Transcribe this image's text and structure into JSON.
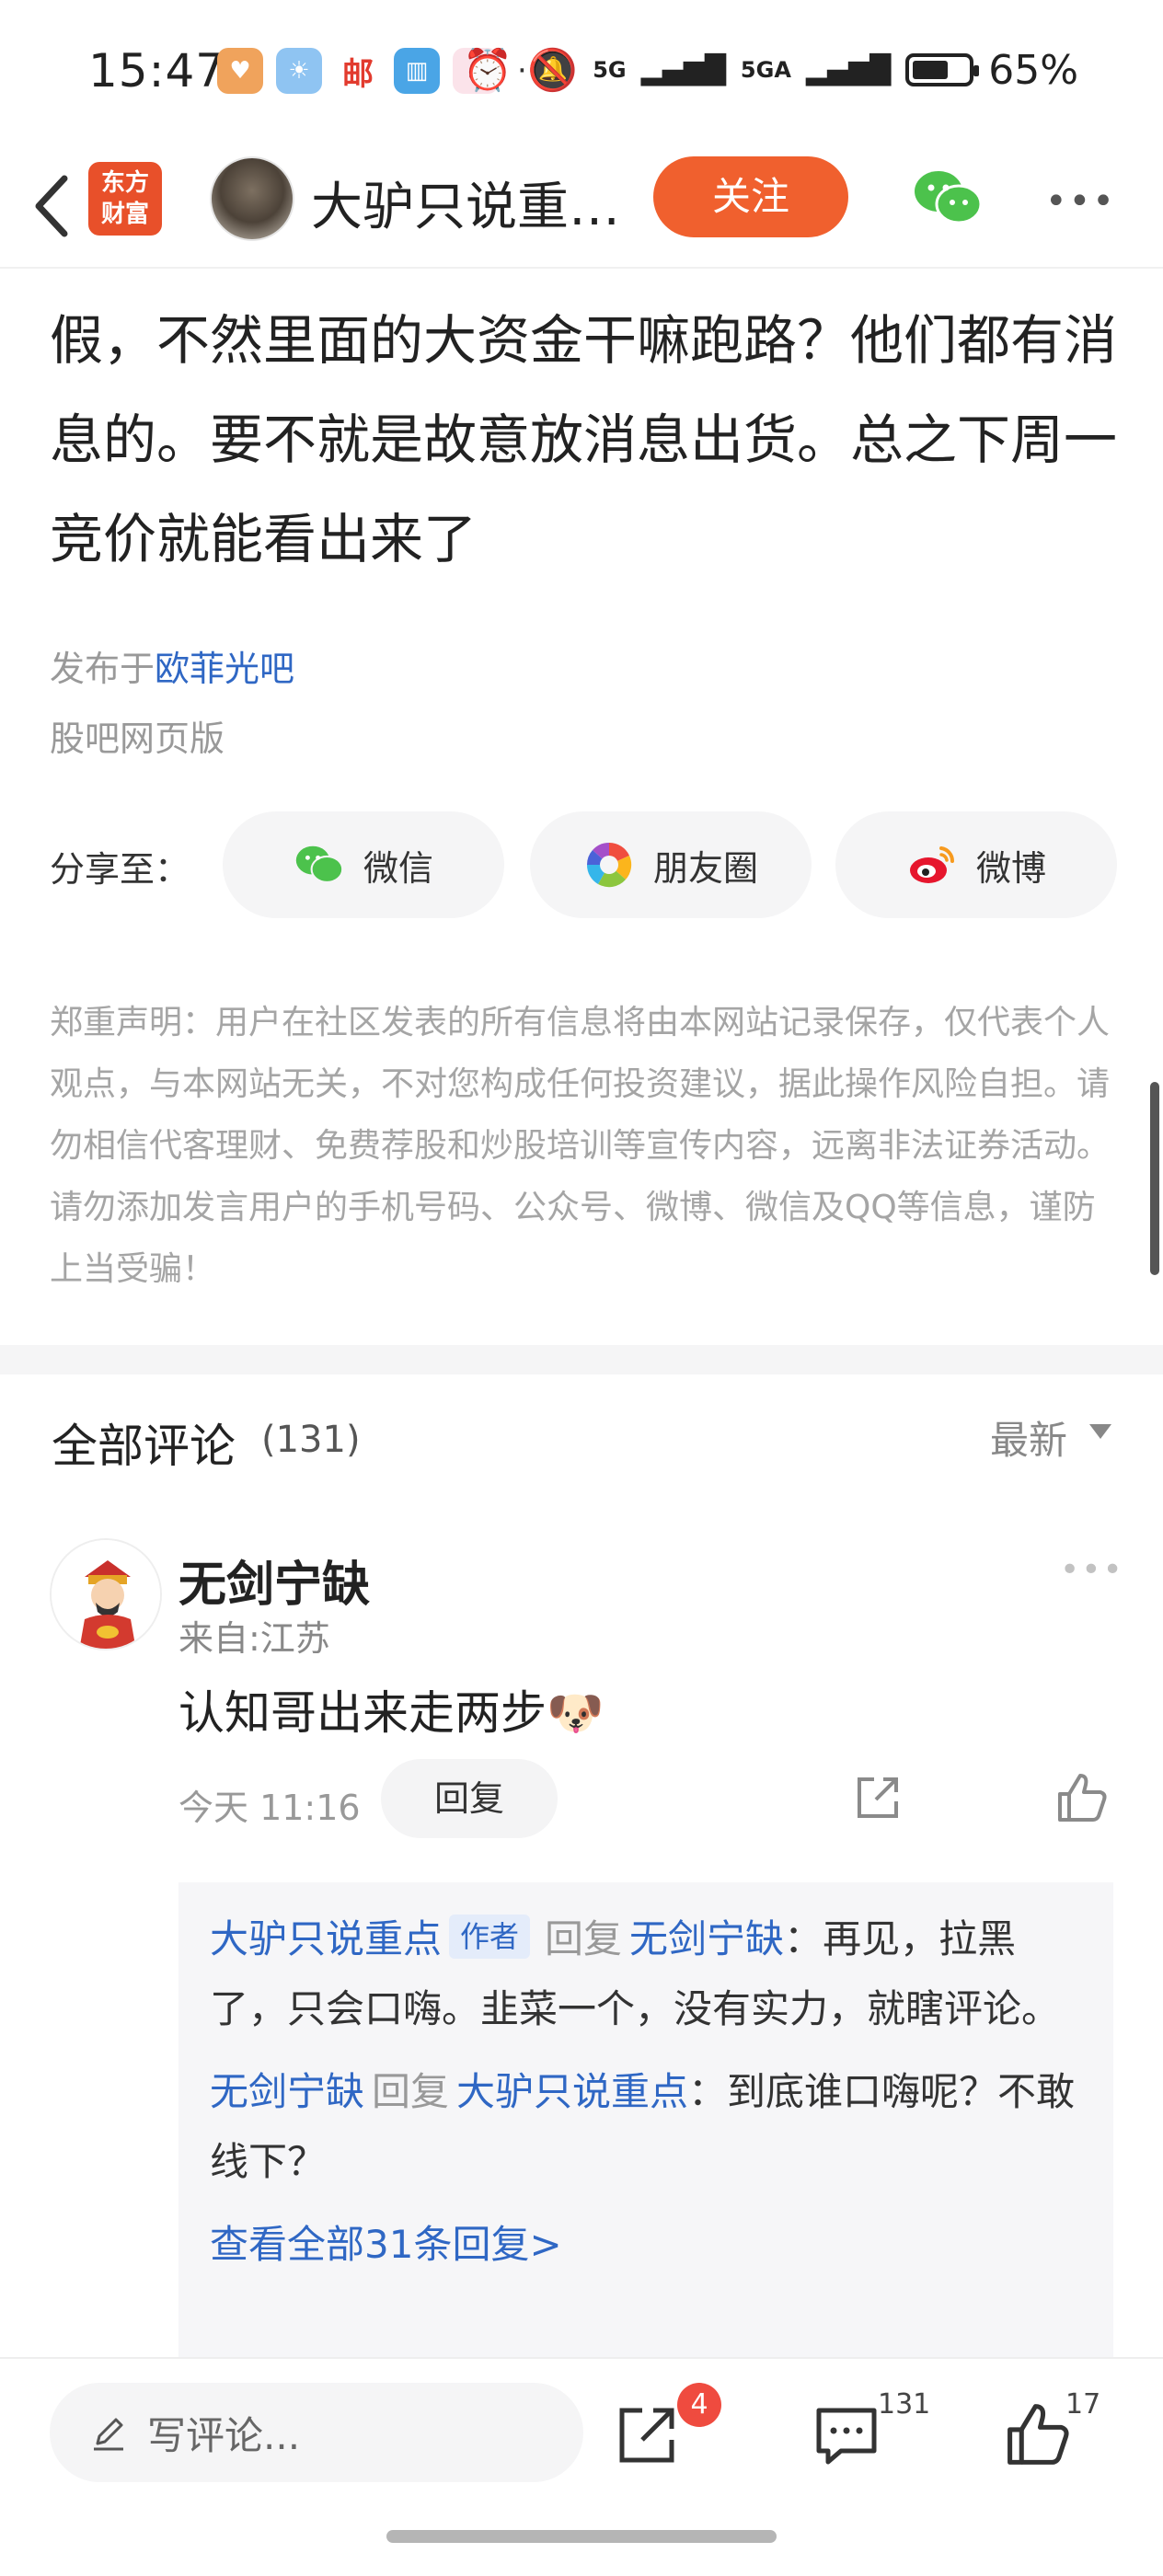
{
  "status_bar": {
    "time": "15:47",
    "network_1": "5G",
    "network_2": "5GA",
    "battery": "65%",
    "battery_level": 0.65
  },
  "header": {
    "logo_line1": "东方",
    "logo_line2": "财富",
    "title": "大驴只说重…",
    "follow_label": "关注"
  },
  "article": {
    "text": "假，不然里面的大资金干嘛跑路？他们都有消息的。要不就是故意放消息出货。总之下周一竞价就能看出来了",
    "published_prefix": "发布于",
    "published_bar": "欧菲光吧",
    "source": "股吧网页版"
  },
  "share": {
    "label": "分享至：",
    "buttons": [
      {
        "label": "微信",
        "icon": "wechat-icon"
      },
      {
        "label": "朋友圈",
        "icon": "moments-icon"
      },
      {
        "label": "微博",
        "icon": "weibo-icon"
      }
    ]
  },
  "disclaimer": "郑重声明：用户在社区发表的所有信息将由本网站记录保存，仅代表个人观点，与本网站无关，不对您构成任何投资建议，据此操作风险自担。请勿相信代客理财、免费荐股和炒股培训等宣传内容，远离非法证券活动。请勿添加发言用户的手机号码、公众号、微博、微信及QQ等信息，谨防上当受骗！",
  "comments": {
    "title": "全部评论",
    "count": "(131)",
    "sort_label": "最新",
    "items": [
      {
        "user": "无剑宁缺",
        "location": "来自:江苏",
        "text": "认知哥出来走两步🐶",
        "time": "今天 11:16",
        "reply_label": "回复",
        "replies": [
          {
            "from": "大驴只说重点",
            "tag": "作者",
            "verb": "回复",
            "to": "无剑宁缺",
            "text": "：再见，拉黑了，只会口嗨。韭菜一个，没有实力，就瞎评论。"
          },
          {
            "from": "无剑宁缺",
            "tag": "",
            "verb": "回复",
            "to": "大驴只说重点",
            "text": "：到底谁口嗨呢？不敢线下？"
          }
        ],
        "view_all": "查看全部31条回复>"
      }
    ]
  },
  "bottom_bar": {
    "input_placeholder": "写评论...",
    "share_badge": "4",
    "comment_count": "131",
    "like_count": "17"
  },
  "colors": {
    "brand_orange": "#f0602e",
    "link_blue": "#2f67c4",
    "badge_red": "#ef4b3f"
  }
}
